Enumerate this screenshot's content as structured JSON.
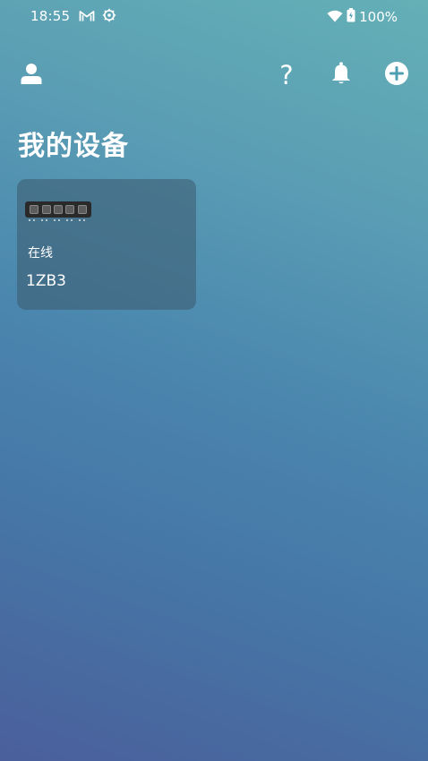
{
  "status_bar": {
    "time": "18:55",
    "battery": "100%",
    "icons": [
      "gmail-icon",
      "settings-sync-icon",
      "wifi-icon",
      "battery-icon"
    ]
  },
  "toolbar": {
    "icons": [
      "user-icon",
      "help-icon",
      "notification-bell-icon",
      "add-circle-icon"
    ],
    "help_glyph": "?"
  },
  "page": {
    "title": "我的设备"
  },
  "devices": [
    {
      "status": "在线",
      "name": "1ZB3",
      "image": "breaker-panel-icon"
    }
  ],
  "colors": {
    "gradient_top": "#64b0b6",
    "gradient_bottom": "#4a5f9c",
    "card_bg": "rgba(60, 90, 110, 0.55)"
  }
}
